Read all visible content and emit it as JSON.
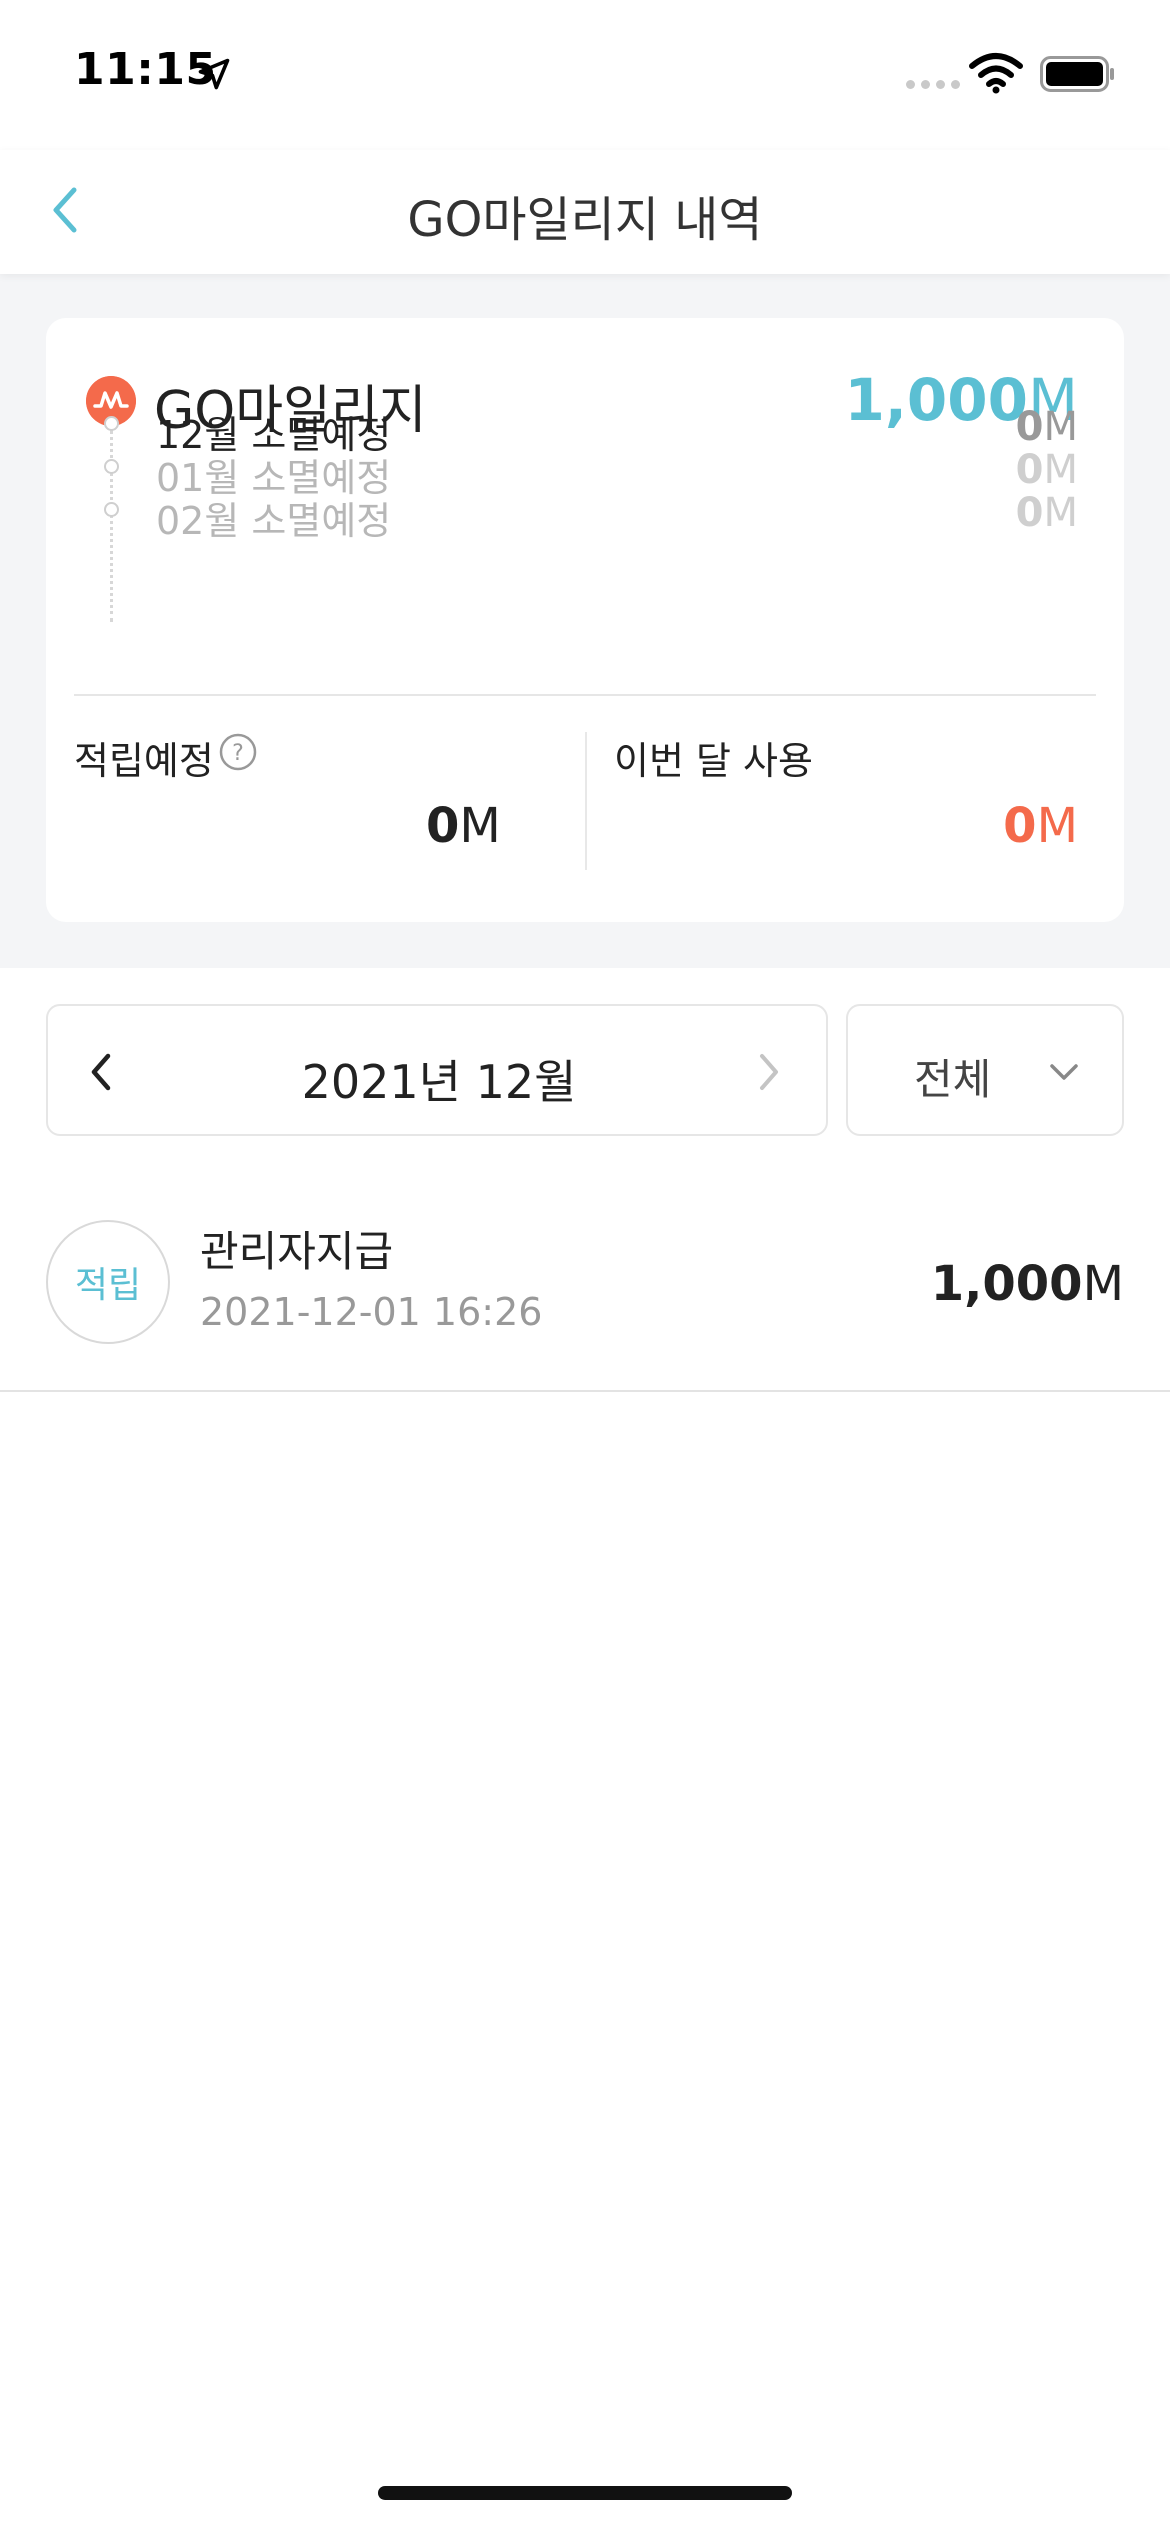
{
  "status_bar": {
    "time": "11:15"
  },
  "nav": {
    "title": "GO마일리지 내역"
  },
  "summary": {
    "title": "GO마일리지",
    "total": {
      "number": "1,000",
      "unit": "M"
    },
    "expirations": [
      {
        "label": "12월 소멸예정",
        "number": "0",
        "unit": "M"
      },
      {
        "label": "01월 소멸예정",
        "number": "0",
        "unit": "M"
      },
      {
        "label": "02월 소멸예정",
        "number": "0",
        "unit": "M"
      }
    ],
    "pending": {
      "label": "적립예정",
      "number": "0",
      "unit": "M"
    },
    "used_this_month": {
      "label": "이번 달 사용",
      "number": "0",
      "unit": "M"
    }
  },
  "filter": {
    "month": "2021년 12월",
    "type": "전체"
  },
  "transactions": [
    {
      "badge": "적립",
      "title": "관리자지급",
      "date": "2021-12-01 16:26",
      "number": "1,000",
      "unit": "M"
    }
  ],
  "colors": {
    "accent_blue": "#5bbfd3",
    "accent_orange": "#f46a4b",
    "background_gray": "#f4f5f7"
  }
}
